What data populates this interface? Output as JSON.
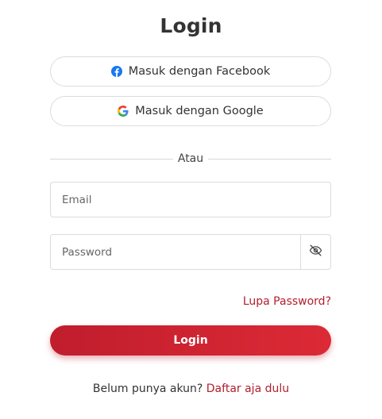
{
  "page": {
    "title": "Login"
  },
  "social": {
    "facebook_label": "Masuk dengan Facebook",
    "facebook_icon": "facebook-icon",
    "facebook_color": "#1877f2",
    "google_label": "Masuk dengan Google",
    "google_icon": "google-icon"
  },
  "divider": {
    "text": "Atau"
  },
  "form": {
    "email_placeholder": "Email",
    "email_value": "",
    "password_placeholder": "Password",
    "password_value": "",
    "password_toggle_icon": "eye-off-icon",
    "forgot_label": "Lupa Password?",
    "submit_label": "Login"
  },
  "signup": {
    "prompt": "Belum punya akun?",
    "link_label": "Daftar aja dulu"
  },
  "colors": {
    "accent": "#c01d2d",
    "link": "#b0202e"
  }
}
